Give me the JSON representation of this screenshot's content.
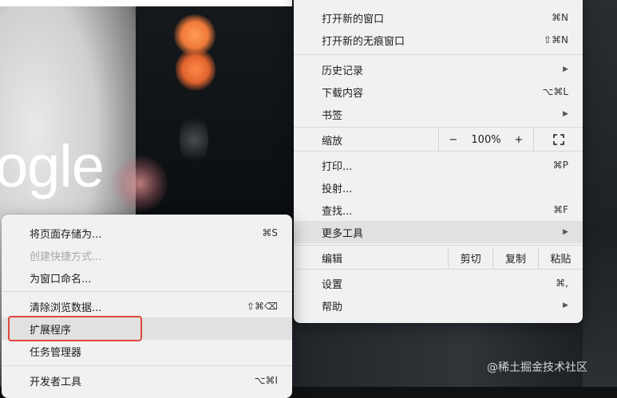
{
  "background": {
    "brand_text": "ogle"
  },
  "main_menu": {
    "items": [
      {
        "label": "打开新的窗口",
        "shortcut": "⌘N"
      },
      {
        "label": "打开新的无痕窗口",
        "shortcut": "⇧⌘N"
      },
      {
        "label": "历史记录",
        "submenu": true
      },
      {
        "label": "下载内容",
        "shortcut": "⌥⌘L"
      },
      {
        "label": "书签",
        "submenu": true
      },
      {
        "label": "打印...",
        "shortcut": "⌘P"
      },
      {
        "label": "投射..."
      },
      {
        "label": "查找...",
        "shortcut": "⌘F"
      },
      {
        "label": "更多工具",
        "submenu": true
      },
      {
        "label": "设置",
        "shortcut": "⌘,"
      },
      {
        "label": "帮助",
        "submenu": true
      }
    ],
    "zoom": {
      "label": "缩放",
      "minus": "−",
      "value": "100%",
      "plus": "+",
      "fullscreen_icon": "fullscreen-icon"
    },
    "edit": {
      "label": "编辑",
      "cut": "剪切",
      "copy": "复制",
      "paste": "粘贴"
    },
    "submenu_arrow": "▶"
  },
  "sub_menu": {
    "items": [
      {
        "label": "将页面存储为...",
        "shortcut": "⌘S"
      },
      {
        "label": "创建快捷方式...",
        "disabled": true
      },
      {
        "label": "为窗口命名..."
      },
      {
        "label": "清除浏览数据...",
        "shortcut": "⇧⌘⌫"
      },
      {
        "label": "扩展程序",
        "highlighted": true
      },
      {
        "label": "任务管理器"
      },
      {
        "label": "开发者工具",
        "shortcut": "⌥⌘I"
      }
    ]
  },
  "watermark": "@稀土掘金技术社区",
  "colors": {
    "highlight_border": "#e0483c",
    "menu_bg": "#f1f1f1",
    "hover_bg": "#e1e1e1"
  }
}
